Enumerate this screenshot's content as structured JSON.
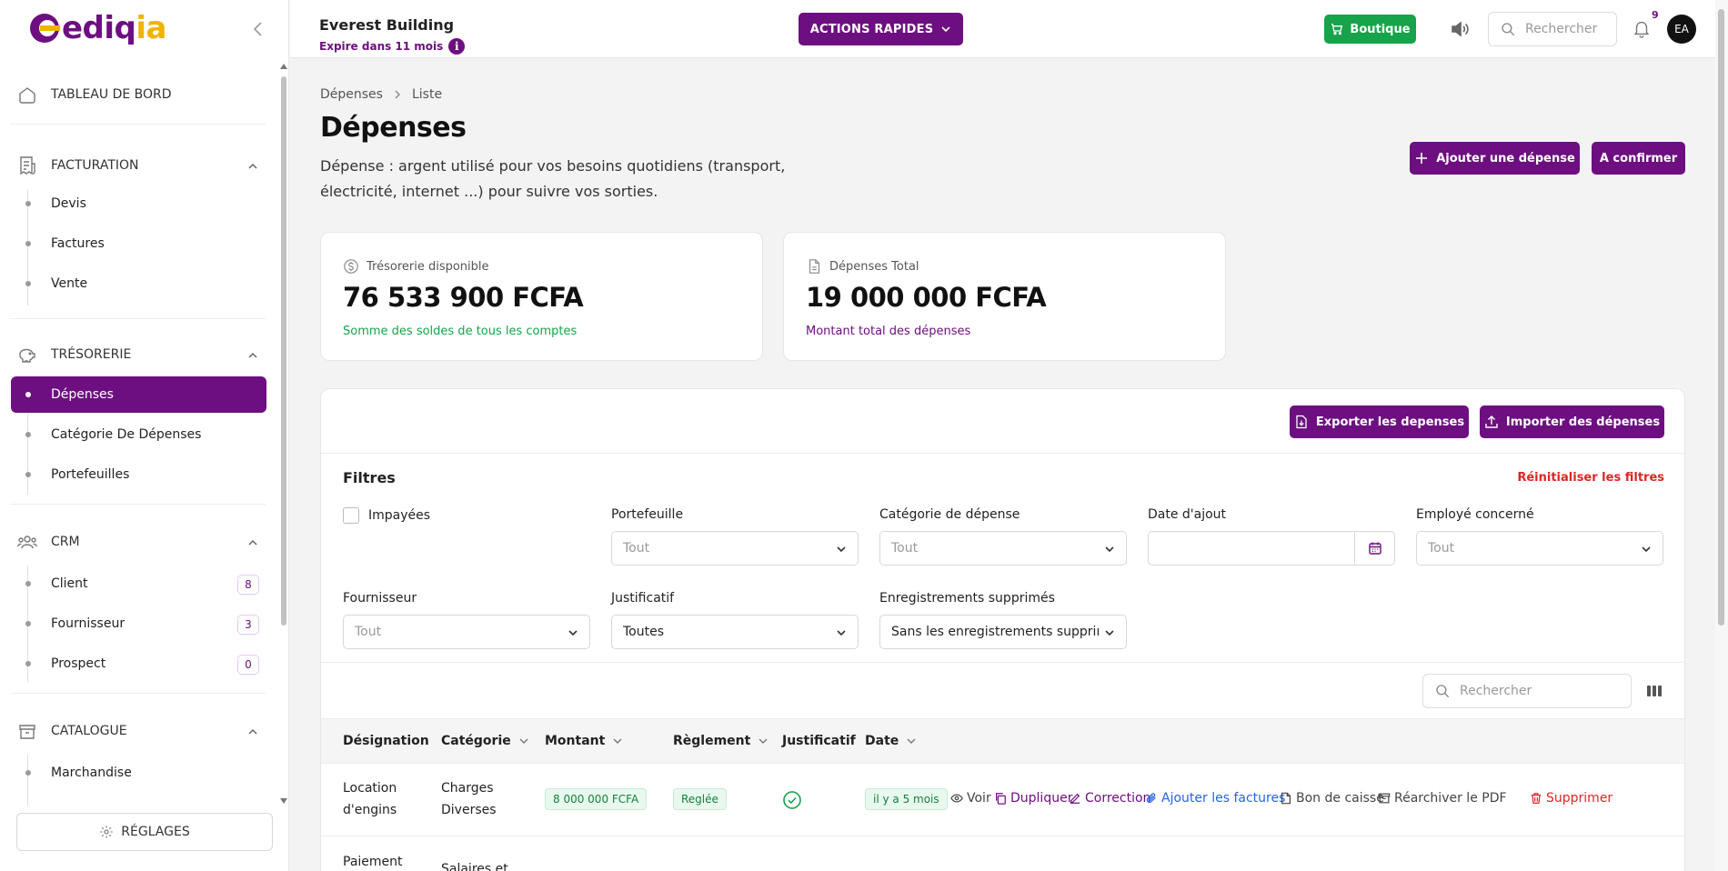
{
  "app": {
    "logo_main": "ediq",
    "logo_accent": "ia"
  },
  "sidebar": {
    "dashboard": "TABLEAU DE BORD",
    "sections": [
      {
        "title": "FACTURATION",
        "items": [
          {
            "label": "Devis"
          },
          {
            "label": "Factures"
          },
          {
            "label": "Vente"
          }
        ]
      },
      {
        "title": "TRÉSORERIE",
        "items": [
          {
            "label": "Dépenses",
            "active": true
          },
          {
            "label": "Catégorie De Dépenses"
          },
          {
            "label": "Portefeuilles"
          }
        ]
      },
      {
        "title": "CRM",
        "items": [
          {
            "label": "Client",
            "count": "8"
          },
          {
            "label": "Fournisseur",
            "count": "3"
          },
          {
            "label": "Prospect",
            "count": "0"
          }
        ]
      },
      {
        "title": "CATALOGUE",
        "items": [
          {
            "label": "Marchandise"
          }
        ]
      }
    ],
    "settings": "RÉGLAGES"
  },
  "topbar": {
    "company": "Everest Building",
    "expiry": "Expire dans 11 mois",
    "info_glyph": "i",
    "quick_actions": "ACTIONS RAPIDES",
    "shop": "Boutique",
    "search_placeholder": "Rechercher",
    "notif_count": "9",
    "avatar": "EA"
  },
  "page": {
    "breadcrumb": [
      "Dépenses",
      "Liste"
    ],
    "title": "Dépenses",
    "description": "Dépense : argent utilisé pour vos besoins quotidiens (transport, électricité, internet ...) pour suivre vos sorties.",
    "add_button": "Ajouter une dépense",
    "confirm_button": "A confirmer"
  },
  "stats": [
    {
      "label": "Trésorerie disponible",
      "value": "76 533 900 FCFA",
      "hint": "Somme des soldes de tous les comptes",
      "hint_color": "#16a34a"
    },
    {
      "label": "Dépenses Total",
      "value": "19 000 000 FCFA",
      "hint": "Montant total des dépenses",
      "hint_color": "#6d0f80"
    }
  ],
  "panel": {
    "export": "Exporter les depenses",
    "import": "Importer des dépenses",
    "filters_title": "Filtres",
    "reset": "Réinitialiser les filtres",
    "unpaid": "Impayées",
    "filters": {
      "portefeuille": {
        "label": "Portefeuille",
        "value": "Tout"
      },
      "categorie": {
        "label": "Catégorie de dépense",
        "value": "Tout"
      },
      "date": {
        "label": "Date d'ajout",
        "value": ""
      },
      "employe": {
        "label": "Employé concerné",
        "value": "Tout"
      },
      "fournisseur": {
        "label": "Fournisseur",
        "value": "Tout"
      },
      "justificatif": {
        "label": "Justificatif",
        "value": "Toutes"
      },
      "supprimes": {
        "label": "Enregistrements supprimés",
        "value": "Sans les enregistrements supprimés"
      }
    },
    "search_placeholder": "Rechercher"
  },
  "table": {
    "headers": {
      "designation": "Désignation",
      "categorie": "Catégorie",
      "montant": "Montant",
      "reglement": "Règlement",
      "justificatif": "Justificatif",
      "date": "Date"
    },
    "rows": [
      {
        "designation_1": "Location",
        "designation_2": "d'engins",
        "categorie_1": "Charges",
        "categorie_2": "Diverses",
        "montant": "8 000 000 FCFA",
        "reglement": "Reglée",
        "justificatif": true,
        "date": "il y a 5 mois"
      },
      {
        "designation_1": "Paiement",
        "designation_2": "",
        "categorie_1": "Salaires et",
        "categorie_2": "",
        "montant": "",
        "reglement": "",
        "justificatif": false,
        "date": ""
      }
    ],
    "actions": {
      "voir": "Voir",
      "dupliquer": "Dupliquer",
      "correction": "Correction",
      "factures": "Ajouter les factures",
      "bon": "Bon de caisse",
      "rearchiver": "Réarchiver le PDF",
      "supprimer": "Supprimer"
    }
  }
}
